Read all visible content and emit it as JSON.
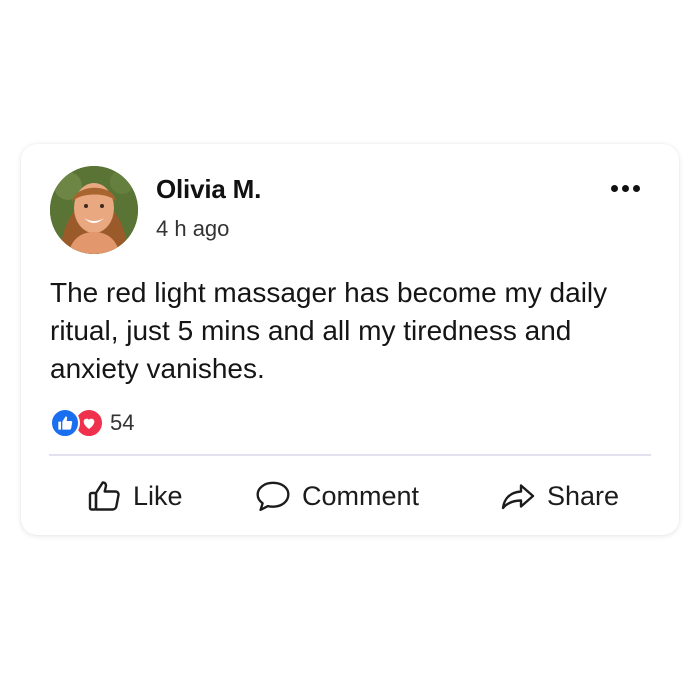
{
  "post": {
    "author": "Olivia M.",
    "time": "4 h ago",
    "text": "The red light massager has become my daily ritual, just 5 mins and all my tiredness and anxiety vanishes.",
    "reactions": {
      "icons": [
        "like-icon",
        "love-icon"
      ],
      "count": "54"
    },
    "actions": {
      "like_label": "Like",
      "comment_label": "Comment",
      "share_label": "Share"
    },
    "menu_icon": "more-options-icon"
  },
  "colors": {
    "like_blue": "#1a6ff0",
    "love_red": "#f0314e",
    "divider": "#e1e1ef"
  }
}
